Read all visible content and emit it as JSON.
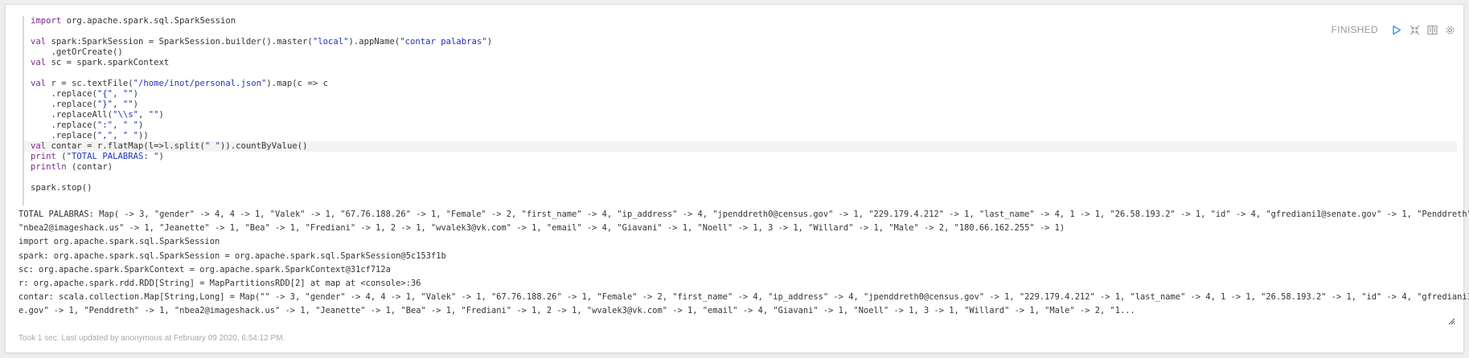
{
  "paragraph": {
    "status": "FINISHED",
    "toolbar": {
      "run_icon": "run-triangle-icon",
      "toggle_editor_icon": "arrows-collapse-icon",
      "table_icon": "book-icon",
      "settings_icon": "gear-icon"
    },
    "code": {
      "lines": [
        [
          [
            "kw",
            "import"
          ],
          [
            "",
            "org.apache.spark.sql.SparkSession"
          ]
        ],
        [],
        [
          [
            "kw",
            "val"
          ],
          [
            "",
            "spark:SparkSession = SparkSession.builder().master("
          ],
          [
            "str",
            "\"local\""
          ],
          [
            "",
            ").appName("
          ],
          [
            "str",
            "\"contar palabras\""
          ],
          [
            "",
            ")"
          ]
        ],
        [
          [
            "",
            "    .getOrCreate()"
          ]
        ],
        [
          [
            "kw",
            "val"
          ],
          [
            "",
            "sc = spark.sparkContext"
          ]
        ],
        [],
        [
          [
            "kw",
            "val"
          ],
          [
            "",
            "r = sc.textFile("
          ],
          [
            "str",
            "\"/home/inot/personal.json\""
          ],
          [
            "",
            ").map(c => c"
          ]
        ],
        [
          [
            "",
            "    .replace("
          ],
          [
            "str",
            "\"{\""
          ],
          [
            "",
            ", "
          ],
          [
            "str",
            "\"\""
          ],
          [
            "",
            ")"
          ]
        ],
        [
          [
            "",
            "    .replace("
          ],
          [
            "str",
            "\"}\""
          ],
          [
            "",
            ", "
          ],
          [
            "str",
            "\"\""
          ],
          [
            "",
            ")"
          ]
        ],
        [
          [
            "",
            "    .replaceAll("
          ],
          [
            "str",
            "\"\\\\s\""
          ],
          [
            "",
            ", "
          ],
          [
            "str",
            "\"\""
          ],
          [
            "",
            ")"
          ]
        ],
        [
          [
            "",
            "    .replace("
          ],
          [
            "str",
            "\":\""
          ],
          [
            "",
            ", "
          ],
          [
            "str",
            "\" \""
          ],
          [
            "",
            ")"
          ]
        ],
        [
          [
            "",
            "    .replace("
          ],
          [
            "str",
            "\",\""
          ],
          [
            "",
            ", "
          ],
          [
            "str",
            "\" \""
          ],
          [
            "",
            "))"
          ]
        ],
        [
          [
            "kw",
            "val"
          ],
          [
            "",
            "contar = r.flatMap(l=>l.split("
          ],
          [
            "str",
            "\" \""
          ],
          [
            "",
            "))"
          ],
          [
            "",
            ".countByValue()"
          ]
        ],
        [
          [
            "kw",
            "print"
          ],
          [
            "",
            "("
          ],
          [
            "str",
            "\"TOTAL PALABRAS: \""
          ],
          [
            "",
            ")"
          ]
        ],
        [
          [
            "kw",
            "println"
          ],
          [
            "",
            "(contar)"
          ]
        ],
        [],
        [
          [
            "",
            "spark.stop()"
          ]
        ]
      ],
      "active_line": 12
    },
    "output": {
      "lines": [
        "TOTAL PALABRAS: Map( -> 3, \"gender\" -> 4, 4 -> 1, \"Valek\" -> 1, \"67.76.188.26\" -> 1, \"Female\" -> 2, \"first_name\" -> 4, \"ip_address\" -> 4, \"jpenddreth0@census.gov\" -> 1, \"229.179.4.212\" -> 1, \"last_name\" -> 4, 1 -> 1, \"26.58.193.2\" -> 1, \"id\" -> 4, \"gfrediani1@senate.gov\" -> 1, \"Penddreth\" -> 1,",
        "\"nbea2@imageshack.us\" -> 1, \"Jeanette\" -> 1, \"Bea\" -> 1, \"Frediani\" -> 1, 2 -> 1, \"wvalek3@vk.com\" -> 1, \"email\" -> 4, \"Giavani\" -> 1, \"Noell\" -> 1, 3 -> 1, \"Willard\" -> 1, \"Male\" -> 2, \"180.66.162.255\" -> 1)",
        "import org.apache.spark.sql.SparkSession",
        "spark: org.apache.spark.sql.SparkSession = org.apache.spark.sql.SparkSession@5c153f1b",
        "sc: org.apache.spark.SparkContext = org.apache.spark.SparkContext@31cf712a",
        "r: org.apache.spark.rdd.RDD[String] = MapPartitionsRDD[2] at map at <console>:36",
        "contar: scala.collection.Map[String,Long] = Map(\"\" -> 3, \"gender\" -> 4, 4 -> 1, \"Valek\" -> 1, \"67.76.188.26\" -> 1, \"Female\" -> 2, \"first_name\" -> 4, \"ip_address\" -> 4, \"jpenddreth0@census.gov\" -> 1, \"229.179.4.212\" -> 1, \"last_name\" -> 4, 1 -> 1, \"26.58.193.2\" -> 1, \"id\" -> 4, \"gfrediani1@senat",
        "e.gov\" -> 1, \"Penddreth\" -> 1, \"nbea2@imageshack.us\" -> 1, \"Jeanette\" -> 1, \"Bea\" -> 1, \"Frediani\" -> 1, 2 -> 1, \"wvalek3@vk.com\" -> 1, \"email\" -> 4, \"Giavani\" -> 1, \"Noell\" -> 1, 3 -> 1, \"Willard\" -> 1, \"Male\" -> 2, \"1..."
      ]
    },
    "footer": "Took 1 sec. Last updated by anonymous at February 09 2020, 6:54:12 PM.",
    "colors": {
      "keyword": "#7b2d8e",
      "string": "#2232b8",
      "icon": "#4a90d9"
    }
  }
}
